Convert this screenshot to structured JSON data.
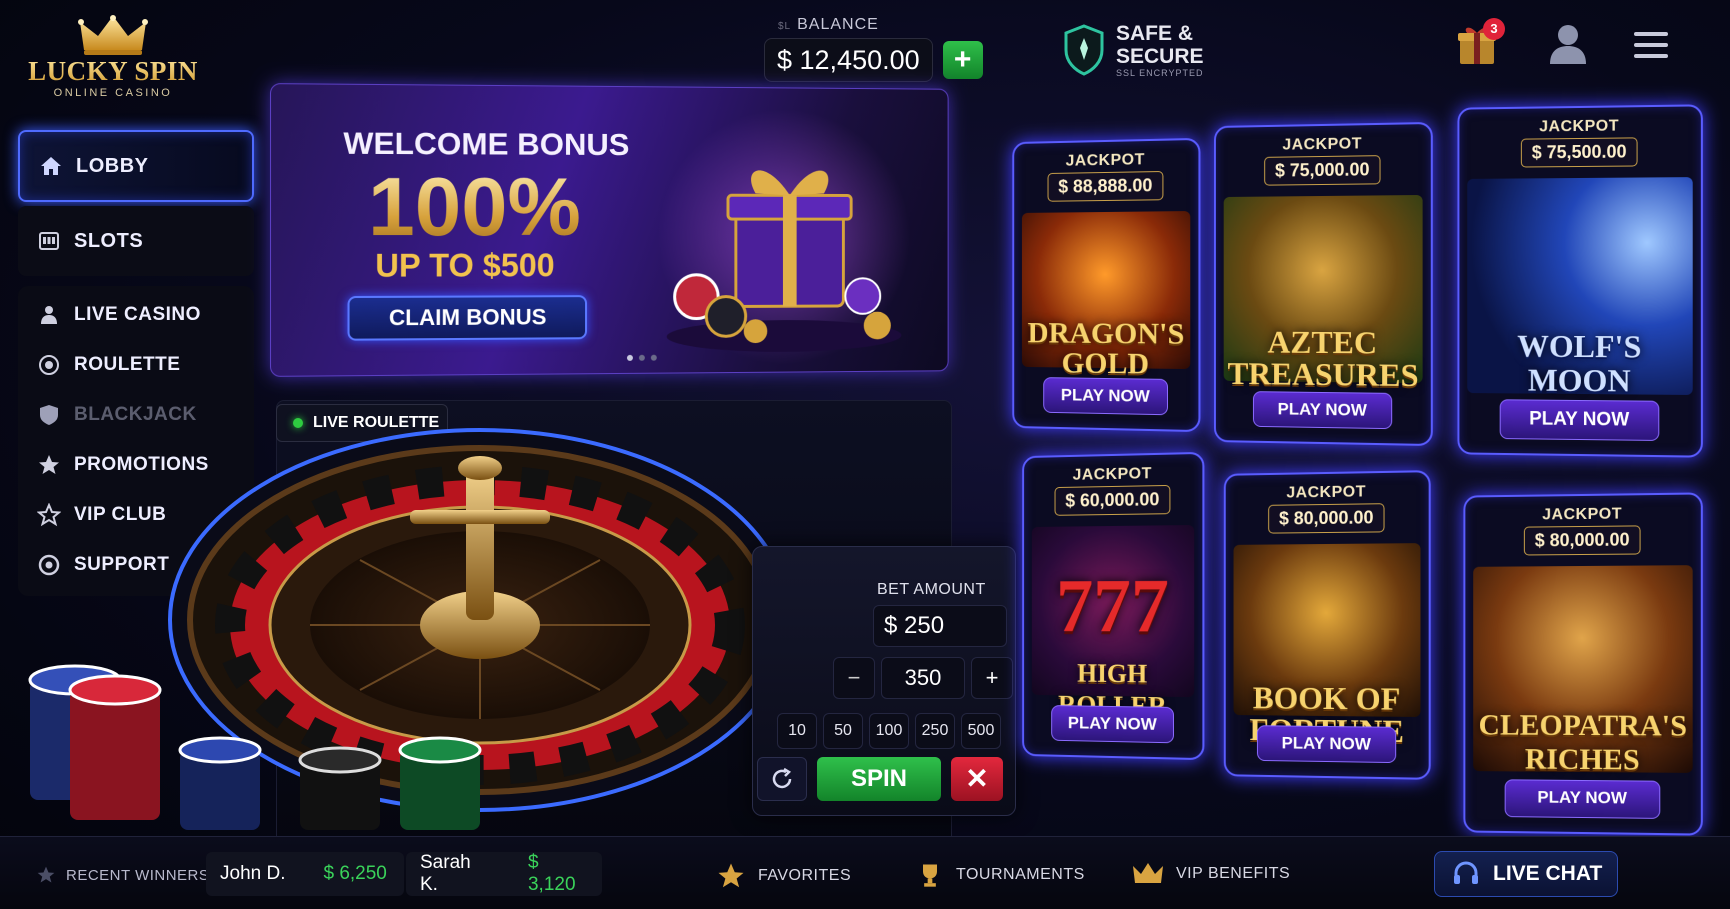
{
  "brand": {
    "name": "LUCKY SPIN",
    "tagline": "ONLINE CASINO"
  },
  "header": {
    "balance_prefix": "$L",
    "balance_label": "BALANCE",
    "balance_value": "$ 12,450.00",
    "add_funds": "+",
    "secure_title_1": "SAFE &",
    "secure_title_2": "SECURE",
    "secure_sub": "SSL ENCRYPTED",
    "gift_badge": "3"
  },
  "sidebar": {
    "items": [
      {
        "label": "LOBBY",
        "icon": "home-icon"
      },
      {
        "label": "SLOTS",
        "icon": "slot-machine-icon"
      },
      {
        "label": "LIVE CASINO",
        "icon": "dealer-icon"
      },
      {
        "label": "ROULETTE",
        "icon": "roulette-icon"
      },
      {
        "label": "BLACKJACK",
        "icon": "shield-card-icon"
      },
      {
        "label": "PROMOTIONS",
        "icon": "star-badge-icon"
      },
      {
        "label": "VIP CLUB",
        "icon": "vip-star-icon"
      },
      {
        "label": "SUPPORT",
        "icon": "support-icon"
      }
    ]
  },
  "banner": {
    "title": "WELCOME BONUS",
    "percent": "100%",
    "subtitle": "UP TO $500",
    "cta": "CLAIM BONUS"
  },
  "live": {
    "tag": "LIVE ROULETTE"
  },
  "bet": {
    "label": "BET AMOUNT",
    "value": "$ 250",
    "stepper_value": "350",
    "minus": "−",
    "plus": "+",
    "quick": [
      "10",
      "50",
      "100",
      "250",
      "500"
    ],
    "spin": "SPIN",
    "cancel": "✕"
  },
  "games": [
    {
      "jackpot_label": "JACKPOT",
      "jackpot": "$ 88,888.00",
      "name_1": "DRAGON'S",
      "name_2": "GOLD",
      "cta": "PLAY NOW"
    },
    {
      "jackpot_label": "JACKPOT",
      "jackpot": "$ 75,000.00",
      "name_1": "AZTEC",
      "name_2": "TREASURES",
      "cta": "PLAY NOW"
    },
    {
      "jackpot_label": "JACKPOT",
      "jackpot": "$ 75,500.00",
      "name_1": "WOLF'S",
      "name_2": "MOON",
      "cta": "PLAY NOW"
    },
    {
      "jackpot_label": "JACKPOT",
      "jackpot": "$ 60,000.00",
      "name_1": "777",
      "name_2": "HIGH ROLLER",
      "cta": "PLAY NOW"
    },
    {
      "jackpot_label": "JACKPOT",
      "jackpot": "$ 80,000.00",
      "name_1": "BOOK OF",
      "name_2": "FORTUNE",
      "cta": "PLAY NOW"
    },
    {
      "jackpot_label": "JACKPOT",
      "jackpot": "$ 80,000.00",
      "name_1": "CLEOPATRA'S",
      "name_2": "RICHES",
      "cta": "PLAY NOW"
    }
  ],
  "footer": {
    "recent_label": "RECENT WINNERS",
    "winners": [
      {
        "name": "John D.",
        "amount": "$ 6,250"
      },
      {
        "name": "Sarah K.",
        "amount": "$ 3,120"
      }
    ],
    "favorites": "FAVORITES",
    "tournaments": "TOURNAMENTS",
    "vip_benefits": "VIP BENEFITS",
    "live_chat": "LIVE CHAT"
  },
  "colors": {
    "accent": "#4f6bff",
    "gold": "#f2c24e",
    "win_green": "#3ad35a",
    "spin_green": "#2fc04b",
    "cancel_red": "#e3283d"
  }
}
